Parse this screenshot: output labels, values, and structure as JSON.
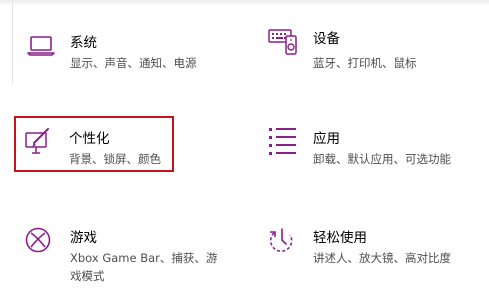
{
  "settings": {
    "accent_color": "#8a1f8e",
    "highlight_color": "#c4141c",
    "items": [
      {
        "title": "系统",
        "desc": "显示、声音、通知、电源",
        "icon": "laptop-icon"
      },
      {
        "title": "设备",
        "desc": "蓝牙、打印机、鼠标",
        "icon": "devices-icon"
      },
      {
        "title": "个性化",
        "desc": "背景、锁屏、颜色",
        "icon": "personalization-icon"
      },
      {
        "title": "应用",
        "desc": "卸载、默认应用、可选功能",
        "icon": "apps-list-icon"
      },
      {
        "title": "游戏",
        "desc": "Xbox Game Bar、捕获、游戏模式",
        "icon": "xbox-icon"
      },
      {
        "title": "轻松使用",
        "desc": "讲述人、放大镜、高对比度",
        "icon": "ease-of-access-icon"
      }
    ]
  }
}
